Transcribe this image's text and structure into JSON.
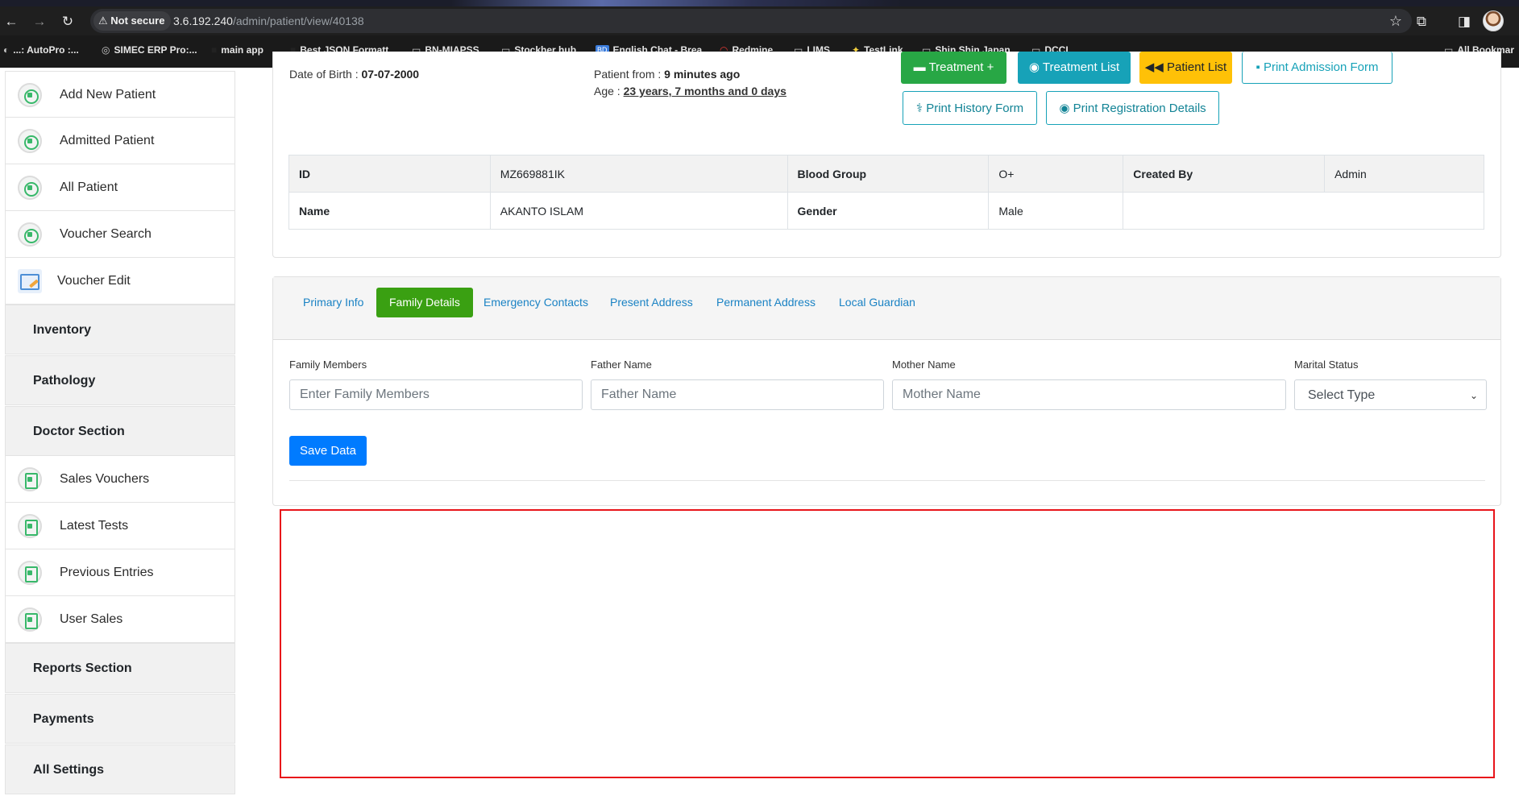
{
  "browser": {
    "security_label": "Not secure",
    "url_host": "3.6.192.240",
    "url_path": "/admin/patient/view/40138",
    "bookmarks": [
      {
        "label": "...: AutoPro :...",
        "icon": "globe-icon"
      },
      {
        "label": "SIMEC ERP Pro:...",
        "icon": "globe-icon"
      },
      {
        "label": "main app",
        "icon": "bookmark-icon"
      },
      {
        "label": "Best JSON Formatt...",
        "icon": "bookmark-icon"
      },
      {
        "label": "BN-MIAPSS",
        "icon": "folder-icon"
      },
      {
        "label": "Stockher hub",
        "icon": "folder-icon"
      },
      {
        "label": "English Chat - Brea...",
        "icon": "bd-icon"
      },
      {
        "label": "Redmine",
        "icon": "redmine-icon"
      },
      {
        "label": "LIMS",
        "icon": "folder-icon"
      },
      {
        "label": "TestLink",
        "icon": "testlink-icon"
      },
      {
        "label": "Shin Shin Japan",
        "icon": "folder-icon"
      },
      {
        "label": "DCCI",
        "icon": "folder-icon"
      },
      {
        "label": "All Bookmar",
        "icon": "folder-icon"
      }
    ]
  },
  "sidebar": {
    "top_items": [
      {
        "label": "Add New Patient",
        "icon": "patient-icon"
      },
      {
        "label": "Admitted Patient",
        "icon": "patient-icon"
      },
      {
        "label": "All Patient",
        "icon": "patient-icon"
      },
      {
        "label": "Voucher Search",
        "icon": "patient-icon"
      },
      {
        "label": "Voucher Edit",
        "icon": "voucher-edit-icon"
      }
    ],
    "sections": [
      "Inventory",
      "Pathology",
      "Doctor Section"
    ],
    "doctor_items": [
      {
        "label": "Sales Vouchers",
        "icon": "document-icon"
      },
      {
        "label": "Latest Tests",
        "icon": "document-icon"
      },
      {
        "label": "Previous Entries",
        "icon": "document-icon"
      },
      {
        "label": "User Sales",
        "icon": "document-icon"
      }
    ],
    "bottom_sections": [
      "Reports Section",
      "Payments",
      "All Settings"
    ]
  },
  "patient": {
    "dob_label": "Date of Birth :",
    "dob_value": "07-07-2000",
    "from_label": "Patient from :",
    "from_value": "9 minutes ago",
    "age_label": "Age :",
    "age_value": "23 years, 7 months and 0 days"
  },
  "actions": {
    "treatment": "Treatment",
    "treatment_list": "Treatment List",
    "patient_list": "Patient List",
    "print_admission": "Print Admission Form",
    "print_history": "Print History Form",
    "print_registration": "Print Registration Details"
  },
  "info_table": {
    "row1": {
      "id_label": "ID",
      "id_value": "MZ669881IK",
      "blood_label": "Blood Group",
      "blood_value": "O+",
      "created_label": "Created By",
      "created_value": "Admin"
    },
    "row2": {
      "name_label": "Name",
      "name_value": "AKANTO ISLAM",
      "gender_label": "Gender",
      "gender_value": "Male"
    }
  },
  "tabs": [
    "Primary Info",
    "Family Details",
    "Emergency Contacts",
    "Present Address",
    "Permanent Address",
    "Local Guardian"
  ],
  "active_tab": "Family Details",
  "form": {
    "family_members_label": "Family Members",
    "family_members_placeholder": "Enter Family Members",
    "father_label": "Father Name",
    "father_placeholder": "Father Name",
    "mother_label": "Mother Name",
    "mother_placeholder": "Mother Name",
    "marital_label": "Marital Status",
    "marital_selected": "Select Type",
    "save_label": "Save Data"
  },
  "colors": {
    "active_tab": "#3aa012",
    "save_button": "#007bff",
    "tab_link": "#1a82c4",
    "annotation_box": "#e8141a"
  }
}
